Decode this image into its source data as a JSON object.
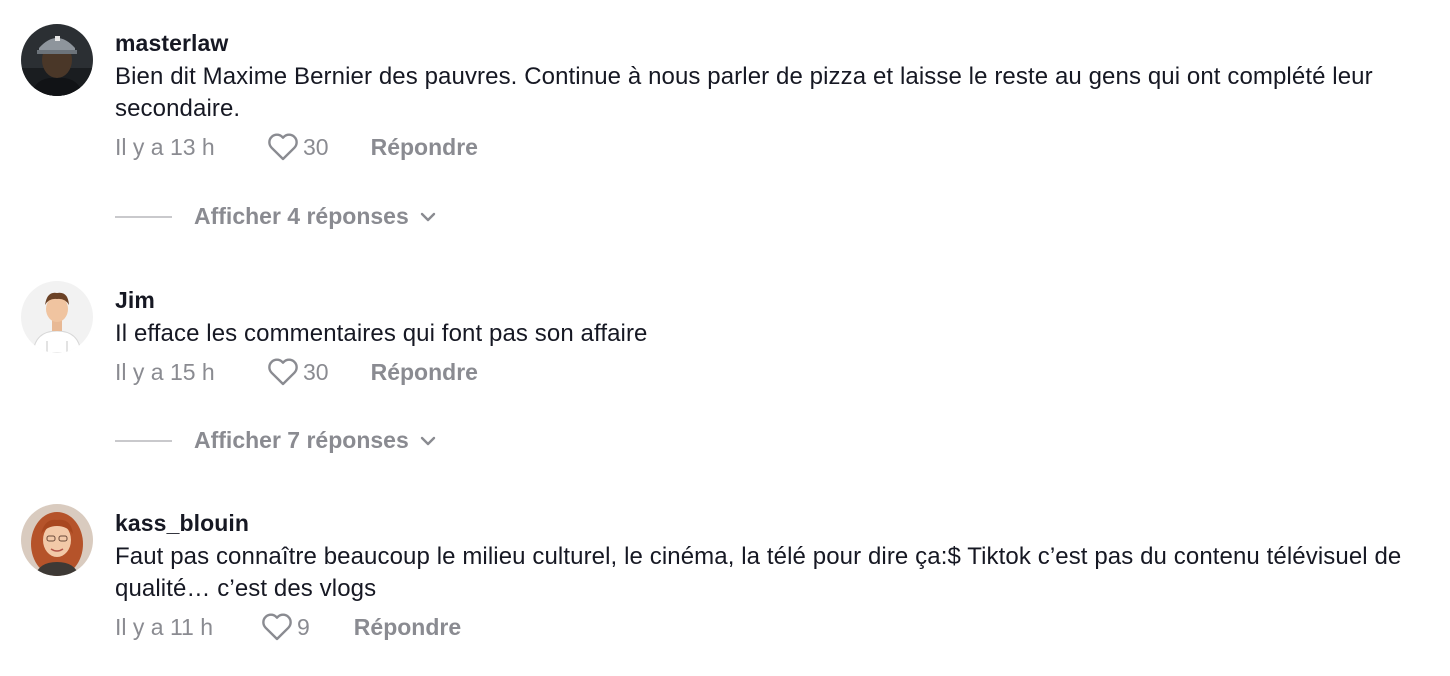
{
  "comments": [
    {
      "username": "masterlaw",
      "text": "Bien dit Maxime Bernier des pauvres. Continue à nous parler de pizza et laisse le reste au gens qui ont complété leur secondaire.",
      "time": "Il y a 13 h",
      "likes": "30",
      "reply_label": "Répondre",
      "view_replies": "Afficher 4 réponses"
    },
    {
      "username": "Jim",
      "text": "Il efface les commentaires qui font pas son affaire",
      "time": "Il y a 15 h",
      "likes": "30",
      "reply_label": "Répondre",
      "view_replies": "Afficher 7 réponses"
    },
    {
      "username": "kass_blouin",
      "text": "Faut pas connaître beaucoup le milieu culturel, le cinéma, la télé pour dire ça:$ Tiktok c’est pas du contenu télévisuel de qualité… c’est des vlogs",
      "time": "Il y a 11 h",
      "likes": "9",
      "reply_label": "Répondre"
    }
  ],
  "colors": {
    "text": "#161823",
    "muted": "#8a8b91",
    "divider": "#c9c9cc"
  }
}
